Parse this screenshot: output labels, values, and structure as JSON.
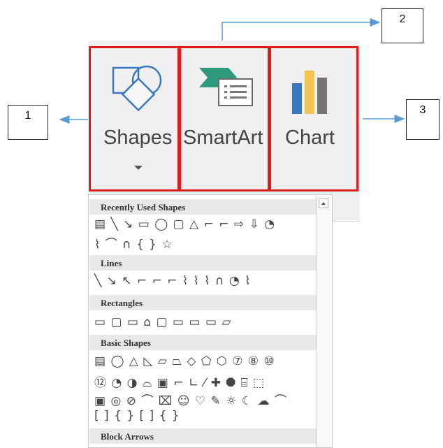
{
  "ribbon": {
    "shapes_label": "Shapes",
    "smartart_label": "SmartArt",
    "chart_label": "Chart",
    "accent_red": "#e11b1b",
    "chart_bar_colors": [
      "#3b78c2",
      "#f2c553",
      "#757575"
    ]
  },
  "callouts": [
    "1",
    "2",
    "3"
  ],
  "gallery": {
    "sections": [
      {
        "title": "Recently Used Shapes",
        "rows": [
          "▤ ╲ ↘ ▭ ◯ ▢ △ ⌐ ⌐ ⇨ ⇩ ◔",
          "⌇ ⌒ ∩ { } ☆"
        ]
      },
      {
        "title": "Lines",
        "rows": [
          "╲ ↘ ↖ ⌐ ⌐ ⌐ ⌇ ⌇ ⌇ ∩ ◔ ⌇"
        ]
      },
      {
        "title": "Rectangles",
        "rows": [
          "▭ ▢ ▭ ⌂ ▢ ▭ ▭ ▭ ▱"
        ]
      },
      {
        "title": "Basic Shapes",
        "rows": [
          "▤ ◯ △ ◺ ▱ ⏢ ◇ ⬠ ⬡ ⑦ ⑧ ⑩",
          "⑫ ◔ ◑ ⌓ ▣ ⌐ ∟ ⁄ ✚ ⯃ ⌸ ⬚",
          "▣ ◎ ⊘ ⌒ ⌧ ☺ ♡ ✎ ☼ ☾ ☁ ⌒",
          "[ ] { } [ ] { }"
        ]
      },
      {
        "title": "Block Arrows",
        "rows": []
      }
    ]
  }
}
